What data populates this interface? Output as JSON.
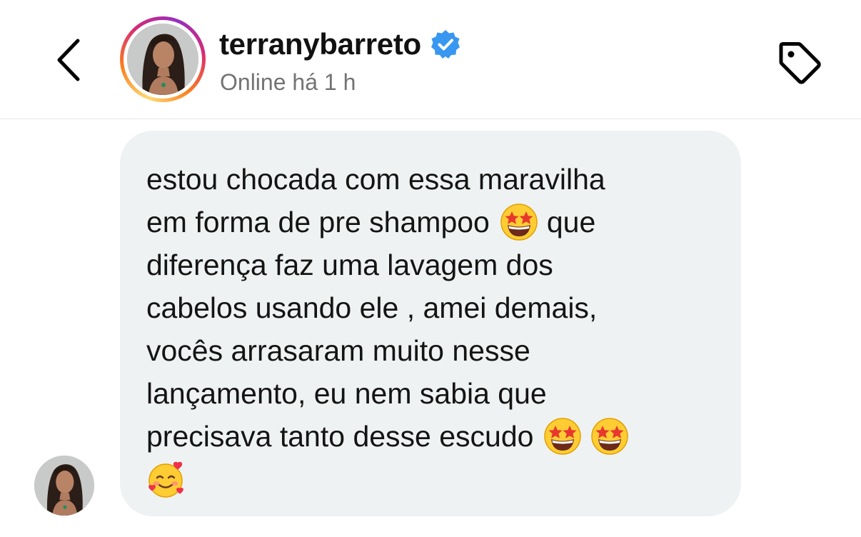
{
  "header": {
    "username": "terranybarreto",
    "status": "Online há 1 h",
    "icons": {
      "back": "chevron-left-icon",
      "verified": "verified-badge-icon",
      "tag": "tag-icon"
    },
    "colors": {
      "verified": "#3897f0",
      "status_text": "#737373"
    }
  },
  "message": {
    "sender": "terranybarreto",
    "bubble_color": "#eff2f2",
    "lines": [
      "estou chocada com essa maravilha",
      "em forma de pre shampoo",
      "que",
      "diferença faz uma lavagem dos",
      "cabelos usando ele , amei demais,",
      "vocês arrasaram muito nesse",
      "lançamento, eu nem sabia que",
      "precisava tanto desse escudo"
    ],
    "emojis": {
      "star_struck": "🤩",
      "smiling_hearts": "🥰"
    }
  }
}
